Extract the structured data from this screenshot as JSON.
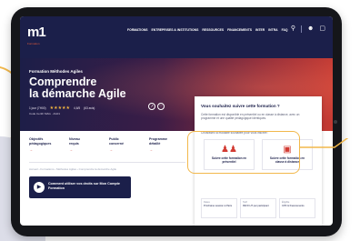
{
  "brand": {
    "logo_text": "m1",
    "logo_subtext": "Formation"
  },
  "nav": {
    "items": [
      "FORMATIONS",
      "ENTREPRISES & INSTITUTIONS",
      "RESSOURCES",
      "FINANCEMENTS",
      "INTER",
      "INTRA",
      "FAQ"
    ],
    "icons": [
      "search-icon",
      "user-icon",
      "cart-icon"
    ]
  },
  "hero": {
    "eyebrow": "Formation Méthodes Agiles",
    "title_line1": "Comprendre",
    "title_line2": "la démarche Agile",
    "duration": "1 jour (7H00)",
    "rating_stars": "★★★★★",
    "rating_value": "4,6/5",
    "reviews": "(63 avis)",
    "code": "Code CertiF MAG · AG01"
  },
  "facts": [
    {
      "title_line1": "Objectifs",
      "title_line2": "pédagogiques",
      "arrow": "→"
    },
    {
      "title_line1": "Niveau",
      "title_line2": "requis",
      "arrow": "→"
    },
    {
      "title_line1": "Public",
      "title_line2": "concerné",
      "arrow": "→"
    },
    {
      "title_line1": "Programme",
      "title_line2": "détaillé",
      "arrow": "→"
    }
  ],
  "breadcrumb": "Accueil › Formations › Méthodes Agiles › Comprendre la démarche Agile",
  "cta": {
    "text": "Comment utiliser vos droits sur Mon Compte Formation"
  },
  "panel": {
    "title": "Vous souhaitez suivre cette formation ?",
    "text": "Cette formation est disponible en présentiel ou en classe à distance, avec un programme et une qualité pédagogique identiques.",
    "subtext": "Choisissez la modalité souhaitée pour vous inscrire :",
    "choice_presentiel": "Suivre cette formation en présentiel",
    "choice_distance": "Suivre cette formation en classe à distance",
    "info": [
      {
        "h": "Dates",
        "v": "Prochaine session à Paris"
      },
      {
        "h": "Tarif",
        "v": "990 € HT par participant"
      },
      {
        "h": "Éligible",
        "v": "CPF & financements"
      }
    ]
  },
  "colors": {
    "navy": "#1b1f4a",
    "accent_red": "#d23b33",
    "highlight": "#f2b84b"
  }
}
